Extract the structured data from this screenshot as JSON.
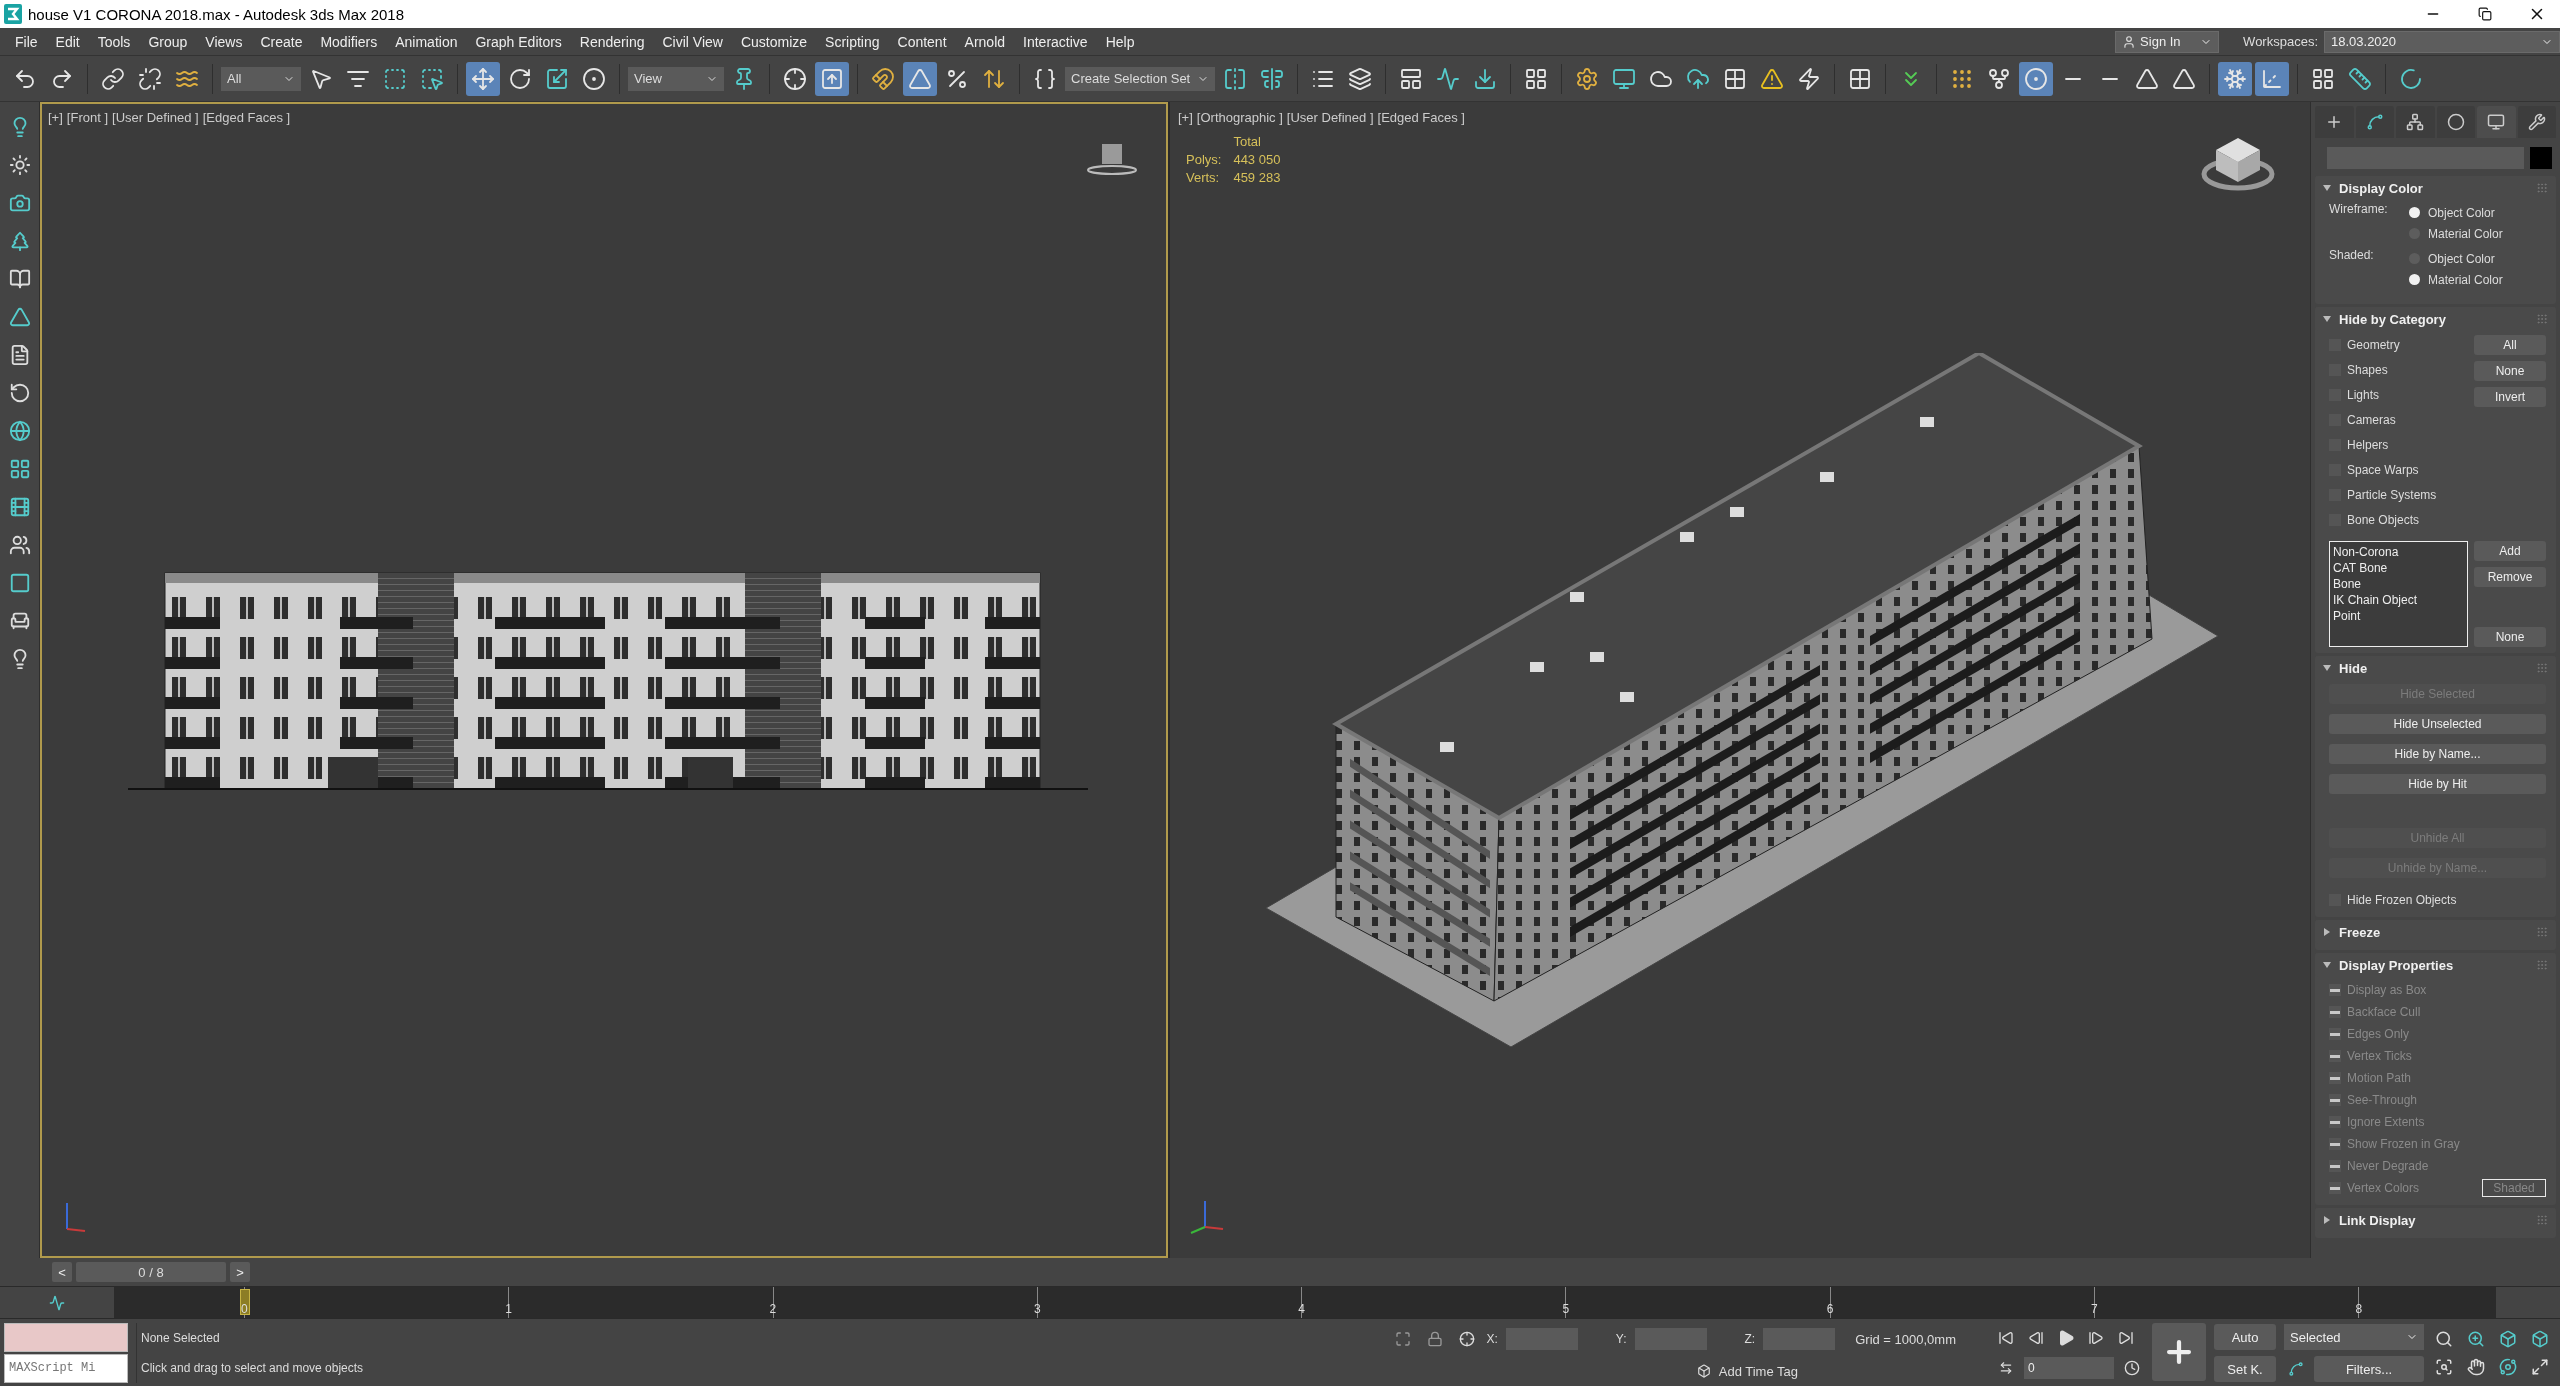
{
  "window": {
    "title": "house V1 CORONA 2018.max - Autodesk 3ds Max 2018"
  },
  "menu": [
    "File",
    "Edit",
    "Tools",
    "Group",
    "Views",
    "Create",
    "Modifiers",
    "Animation",
    "Graph Editors",
    "Rendering",
    "Civil View",
    "Customize",
    "Scripting",
    "Content",
    "Arnold",
    "Interactive",
    "Help"
  ],
  "account": {
    "sign_in": "Sign In",
    "workspaces_label": "Workspaces:",
    "workspace": "18.03.2020"
  },
  "toolbar": [
    {
      "kind": "button",
      "selected": false
    },
    {
      "kind": "button",
      "selected": false
    },
    {
      "kind": "button",
      "selected": false
    },
    {
      "kind": "button",
      "selected": false
    },
    {
      "kind": "button",
      "selected": false
    },
    {
      "kind": "dropdown",
      "value": "All"
    },
    {
      "kind": "button",
      "selected": false
    },
    {
      "kind": "button",
      "selected": false
    },
    {
      "kind": "button",
      "selected": false
    },
    {
      "kind": "button",
      "selected": false
    },
    {
      "kind": "button",
      "selected": true
    },
    {
      "kind": "button",
      "selected": false
    },
    {
      "kind": "button",
      "selected": false
    },
    {
      "kind": "button",
      "selected": false
    },
    {
      "kind": "dropdown",
      "value": "View"
    },
    {
      "kind": "button",
      "selected": false
    },
    {
      "kind": "button",
      "selected": false
    },
    {
      "kind": "button",
      "selected": true
    },
    {
      "kind": "button",
      "selected": false
    },
    {
      "kind": "button",
      "selected": true
    },
    {
      "kind": "button",
      "selected": false
    },
    {
      "kind": "button",
      "selected": false
    },
    {
      "kind": "button",
      "selected": false
    },
    {
      "kind": "dropdown",
      "value": "Create Selection Set"
    },
    {
      "kind": "button",
      "selected": false
    },
    {
      "kind": "button",
      "selected": false
    },
    {
      "kind": "button",
      "selected": false
    },
    {
      "kind": "button",
      "selected": false
    },
    {
      "kind": "button",
      "selected": false
    },
    {
      "kind": "button",
      "selected": false
    },
    {
      "kind": "button",
      "selected": false
    },
    {
      "kind": "button",
      "selected": false
    },
    {
      "kind": "button",
      "selected": false
    },
    {
      "kind": "button",
      "selected": false
    },
    {
      "kind": "button",
      "selected": false
    },
    {
      "kind": "button",
      "selected": false
    },
    {
      "kind": "button",
      "selected": false
    },
    {
      "kind": "button",
      "selected": false
    },
    {
      "kind": "button",
      "selected": false
    },
    {
      "kind": "button",
      "selected": false
    },
    {
      "kind": "button",
      "selected": false
    },
    {
      "kind": "button",
      "selected": false
    },
    {
      "kind": "button",
      "selected": false
    },
    {
      "kind": "button",
      "selected": true
    },
    {
      "kind": "button",
      "selected": false
    },
    {
      "kind": "button",
      "selected": false
    },
    {
      "kind": "button",
      "selected": false
    },
    {
      "kind": "button",
      "selected": false
    },
    {
      "kind": "button",
      "selected": true
    },
    {
      "kind": "button",
      "selected": true
    },
    {
      "kind": "button",
      "selected": false
    },
    {
      "kind": "button",
      "selected": false
    },
    {
      "kind": "button",
      "selected": false
    }
  ],
  "viewports": [
    {
      "labels": [
        "[+]",
        "[Front ]",
        "[User Defined ]",
        "[Edged Faces ]"
      ],
      "active": true,
      "kind": "front"
    },
    {
      "labels": [
        "[+]",
        "[Orthographic ]",
        "[User Defined ]",
        "[Edged Faces ]"
      ],
      "active": false,
      "kind": "ortho",
      "stats": {
        "title": "Total",
        "rows": [
          {
            "label": "Polys:",
            "value": "443 050"
          },
          {
            "label": "Verts:",
            "value": "459 283"
          }
        ]
      }
    }
  ],
  "command_panel": {
    "tabs": [
      {
        "selected": false
      },
      {
        "selected": false
      },
      {
        "selected": false
      },
      {
        "selected": false
      },
      {
        "selected": true
      },
      {
        "selected": false
      }
    ],
    "rollouts": [
      {
        "kind": "display_color",
        "title": "Display Color",
        "expanded": true,
        "groups": [
          {
            "label": "Wireframe:",
            "options": [
              {
                "label": "Object Color",
                "selected": true
              },
              {
                "label": "Material Color",
                "selected": false
              }
            ]
          },
          {
            "label": "Shaded:",
            "options": [
              {
                "label": "Object Color",
                "selected": false
              },
              {
                "label": "Material Color",
                "selected": true
              }
            ]
          }
        ]
      },
      {
        "kind": "hide_by_category",
        "title": "Hide by Category",
        "expanded": true,
        "categories": [
          {
            "label": "Geometry",
            "checked": false
          },
          {
            "label": "Shapes",
            "checked": false
          },
          {
            "label": "Lights",
            "checked": false
          },
          {
            "label": "Cameras",
            "checked": false
          },
          {
            "label": "Helpers",
            "checked": false
          },
          {
            "label": "Space Warps",
            "checked": false
          },
          {
            "label": "Particle Systems",
            "checked": false
          },
          {
            "label": "Bone Objects",
            "checked": false
          }
        ],
        "category_buttons": [
          "All",
          "None",
          "Invert"
        ],
        "list_items": [
          "Non-Corona",
          "CAT Bone",
          "Bone",
          "IK Chain Object",
          "Point"
        ],
        "list_buttons": [
          "Add",
          "Remove",
          "None"
        ]
      },
      {
        "kind": "hide",
        "title": "Hide",
        "expanded": true,
        "buttons": [
          {
            "label": "Hide Selected",
            "disabled": true
          },
          {
            "label": "Hide Unselected",
            "disabled": false
          },
          {
            "label": "Hide by Name...",
            "disabled": false
          },
          {
            "label": "Hide by Hit",
            "disabled": false
          }
        ],
        "unhide_buttons": [
          {
            "label": "Unhide All",
            "disabled": true
          },
          {
            "label": "Unhide by Name...",
            "disabled": true
          }
        ],
        "option": {
          "label": "Hide Frozen Objects",
          "checked": false
        }
      },
      {
        "kind": "freeze",
        "title": "Freeze",
        "expanded": false
      },
      {
        "kind": "display_properties",
        "title": "Display Properties",
        "expanded": true,
        "items": [
          {
            "label": "Display as Box",
            "disabled": true,
            "indeterminate": true
          },
          {
            "label": "Backface Cull",
            "disabled": true,
            "indeterminate": true
          },
          {
            "label": "Edges Only",
            "disabled": true,
            "indeterminate": true
          },
          {
            "label": "Vertex Ticks",
            "disabled": true,
            "indeterminate": true
          },
          {
            "label": "Motion Path",
            "disabled": true,
            "indeterminate": true
          },
          {
            "label": "See-Through",
            "disabled": true,
            "indeterminate": true
          },
          {
            "label": "Ignore Extents",
            "disabled": true,
            "indeterminate": true
          },
          {
            "label": "Show Frozen in Gray",
            "disabled": true,
            "indeterminate": true
          },
          {
            "label": "Never Degrade",
            "disabled": true,
            "indeterminate": true
          },
          {
            "label": "Vertex Colors",
            "disabled": true,
            "indeterminate": true,
            "button": "Shaded"
          }
        ]
      },
      {
        "kind": "link_display",
        "title": "Link Display",
        "expanded": false
      }
    ]
  },
  "time_slider": {
    "prev": "<",
    "next": ">",
    "position": "0 / 8"
  },
  "timeline_ticks": [
    "0",
    "1",
    "2",
    "3",
    "4",
    "5",
    "6",
    "7",
    "8"
  ],
  "status": {
    "listener": "MAXScript Mi",
    "selection": "None Selected",
    "prompt": "Click and drag to select and move objects",
    "x_label": "X:",
    "y_label": "Y:",
    "z_label": "Z:",
    "grid": "Grid = 1000,0mm",
    "time_tag": "Add Time Tag",
    "frame": "0",
    "auto_key": "Auto",
    "set_key": "Set K.",
    "key_filter": "Selected",
    "filters": "Filters..."
  }
}
